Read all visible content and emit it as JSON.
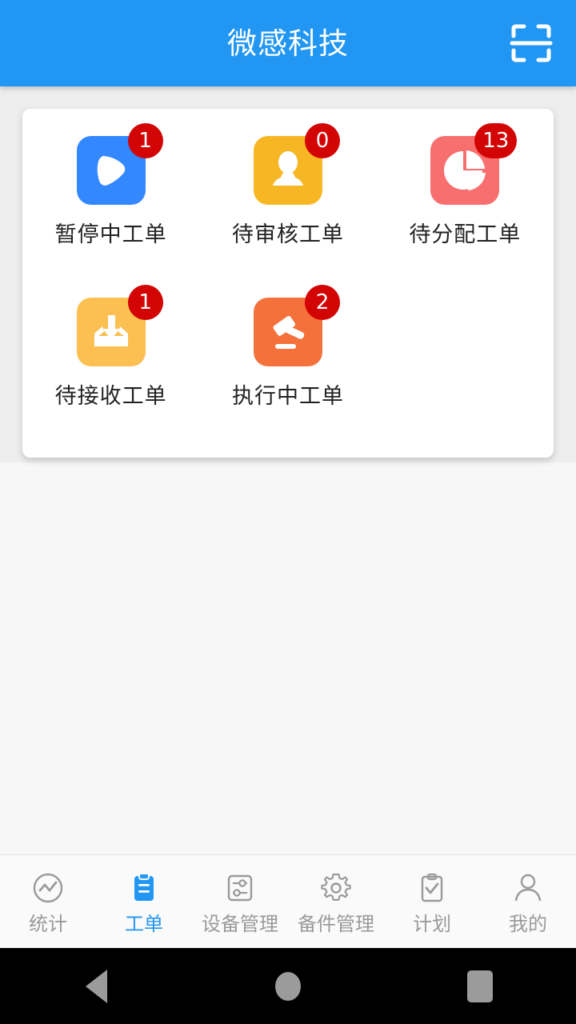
{
  "header": {
    "title": "微感科技",
    "scan_icon": "scan-qr-icon",
    "background_color": "#2196f3"
  },
  "card": {
    "tiles": [
      {
        "label": "暂停中工单",
        "badge": "1",
        "icon": "pause-play-icon",
        "tile_color": "#3388ff"
      },
      {
        "label": "待审核工单",
        "badge": "0",
        "icon": "person-review-icon",
        "tile_color": "#f7b724"
      },
      {
        "label": "待分配工单",
        "badge": "13",
        "icon": "pie-chart-icon",
        "tile_color": "#f7706f"
      },
      {
        "label": "待接收工单",
        "badge": "1",
        "icon": "inbox-download-icon",
        "tile_color": "#fbbf52"
      },
      {
        "label": "执行中工单",
        "badge": "2",
        "icon": "gavel-icon",
        "tile_color": "#f4713c"
      }
    ],
    "badge_color": "#d30404"
  },
  "tabbar": {
    "active_index": 1,
    "active_color": "#2196f3",
    "inactive_color": "#9a9a9a",
    "items": [
      {
        "label": "统计",
        "icon": "chart-circle-icon"
      },
      {
        "label": "工单",
        "icon": "clipboard-lines-icon"
      },
      {
        "label": "设备管理",
        "icon": "sliders-square-icon"
      },
      {
        "label": "备件管理",
        "icon": "gear-icon"
      },
      {
        "label": "计划",
        "icon": "clipboard-check-icon"
      },
      {
        "label": "我的",
        "icon": "person-outline-icon"
      }
    ]
  },
  "system_nav": {
    "back": "back-triangle-icon",
    "home": "home-circle-icon",
    "recents": "recents-square-icon"
  }
}
